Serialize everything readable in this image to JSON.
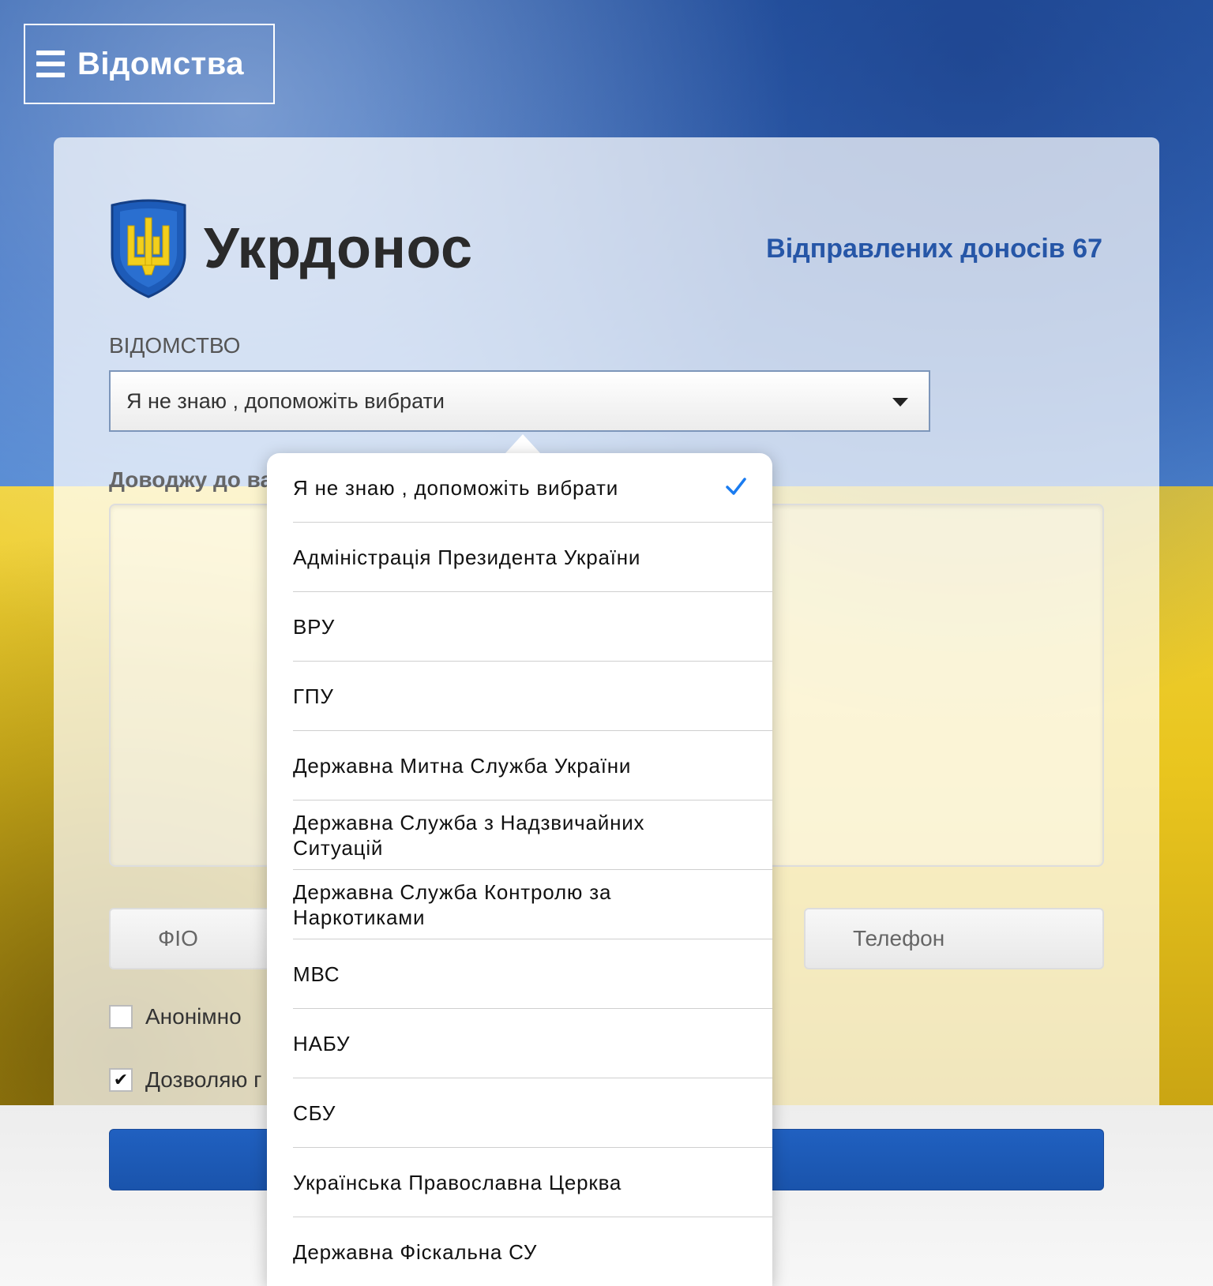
{
  "menu": {
    "label": "Відомства"
  },
  "brand": {
    "title": "Укрдонос",
    "sent_label": "Відправлених доносів",
    "sent_count": "67"
  },
  "form": {
    "department_label": "ВІДОМСТВО",
    "department_selected": "Я не знаю , допоможіть вибрати",
    "message_label": "Доводжу до ва",
    "fio_placeholder": "ФІО",
    "phone_placeholder": "Телефон",
    "anonymous_label": "Анонімно",
    "allow_label": "Дозволяю г",
    "allow_checked": true,
    "anonymous_checked": false
  },
  "dropdown": {
    "options": [
      {
        "label": "Я не знаю , допоможіть вибрати",
        "selected": true
      },
      {
        "label": "Адміністрація Президента України",
        "selected": false
      },
      {
        "label": "ВРУ",
        "selected": false
      },
      {
        "label": "ГПУ",
        "selected": false
      },
      {
        "label": "Державна Митна Служба України",
        "selected": false
      },
      {
        "label": "Державна Служба з Надзвичайних Ситуацій",
        "selected": false
      },
      {
        "label": "Державна Служба Контролю за Наркотиками",
        "selected": false
      },
      {
        "label": "МВС",
        "selected": false
      },
      {
        "label": "НАБУ",
        "selected": false
      },
      {
        "label": "СБУ",
        "selected": false
      },
      {
        "label": "Українська Православна Церква",
        "selected": false
      },
      {
        "label": "Державна Фіскальна СУ",
        "selected": false
      }
    ]
  },
  "colors": {
    "accent": "#2656a7",
    "check": "#1a7cf0",
    "button": "#1a54ac"
  },
  "icons": {
    "menu": "hamburger-icon",
    "logo": "trident-shield-icon",
    "selected": "checkmark-icon",
    "caret": "caret-down-icon"
  }
}
